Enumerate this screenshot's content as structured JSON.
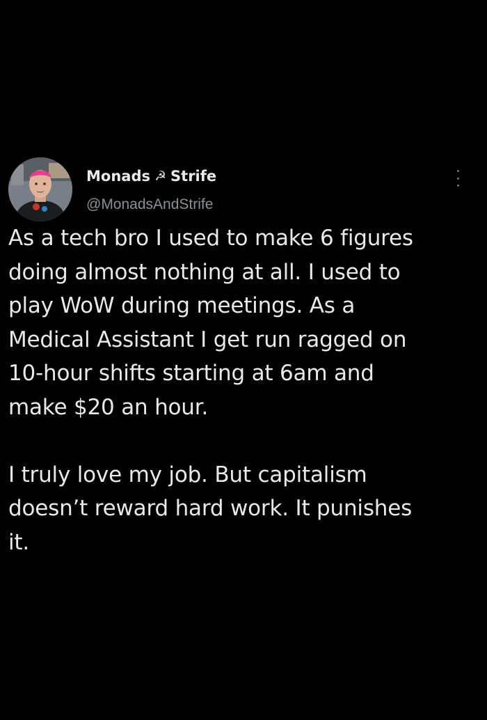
{
  "tweet": {
    "author": {
      "name_part1": "Monads",
      "name_emoji": "☭",
      "name_part2": "Strife",
      "handle": "@MonadsAndStrife"
    },
    "paragraphs": [
      "As a tech bro I used to make 6 figures\ndoing almost nothing at all. I used to\nplay WoW during meetings. As a\nMedical Assistant I get run ragged on\n10-hour shifts starting at 6am and\nmake $20 an hour.",
      "I truly love my job. But capitalism\ndoesn’t reward hard work. It punishes\nit."
    ]
  },
  "colors": {
    "background": "#000000",
    "text": "#e7e9ea",
    "secondary_text": "#8b9096"
  }
}
